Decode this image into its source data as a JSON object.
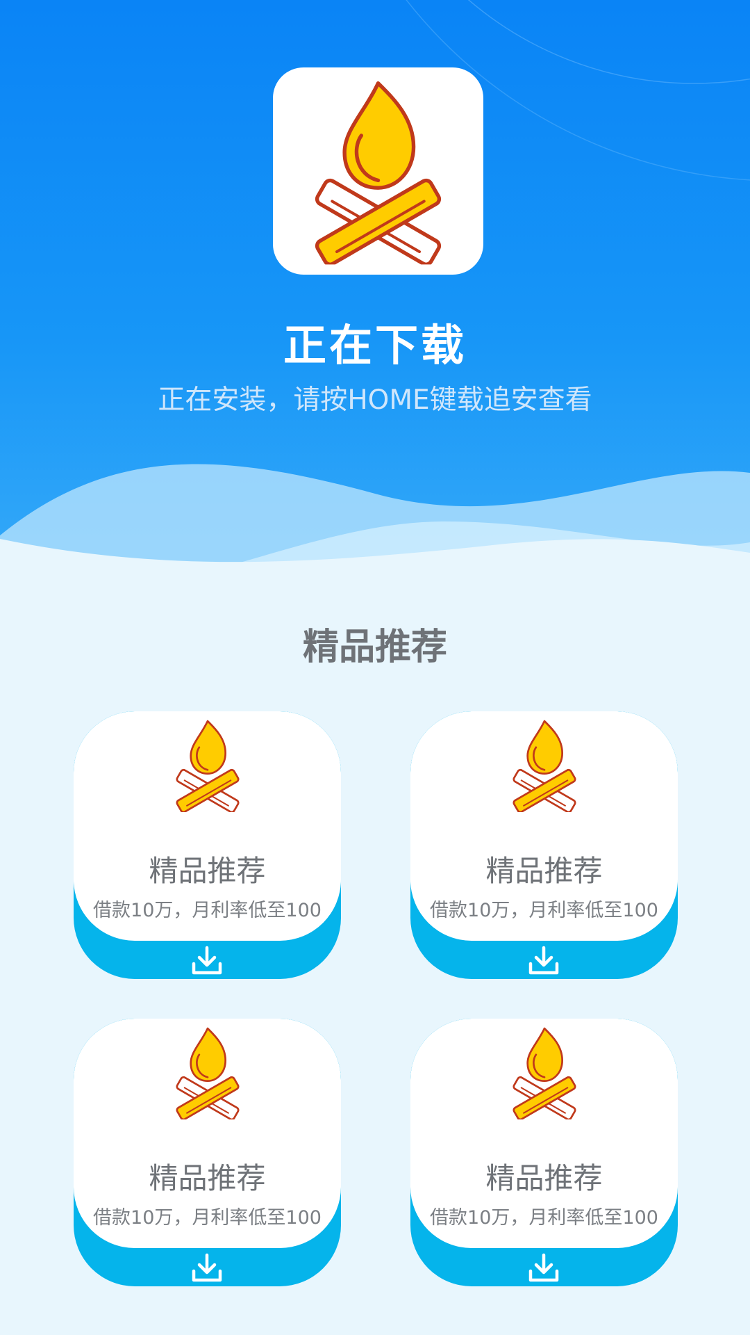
{
  "status": {
    "title": "正在下载",
    "subtitle": "正在安装，请按HOME键载追安查看"
  },
  "app_icon": {
    "icon": "campfire-icon"
  },
  "recommend": {
    "section_title": "精品推荐",
    "cards": [
      {
        "title": "精品推荐",
        "desc": "借款10万，月利率低至100",
        "icon": "campfire-icon",
        "action_icon": "download-icon"
      },
      {
        "title": "精品推荐",
        "desc": "借款10万，月利率低至100",
        "icon": "campfire-icon",
        "action_icon": "download-icon"
      },
      {
        "title": "精品推荐",
        "desc": "借款10万，月利率低至100",
        "icon": "campfire-icon",
        "action_icon": "download-icon"
      },
      {
        "title": "精品推荐",
        "desc": "借款10万，月利率低至100",
        "icon": "campfire-icon",
        "action_icon": "download-icon"
      }
    ]
  },
  "colors": {
    "hero_top": "#0a84f6",
    "hero_bottom": "#39acf8",
    "page_background": "#e8f6fd",
    "card_accent": "#05b4eb",
    "flame": "#ffcc00",
    "outline": "#c0391b"
  }
}
